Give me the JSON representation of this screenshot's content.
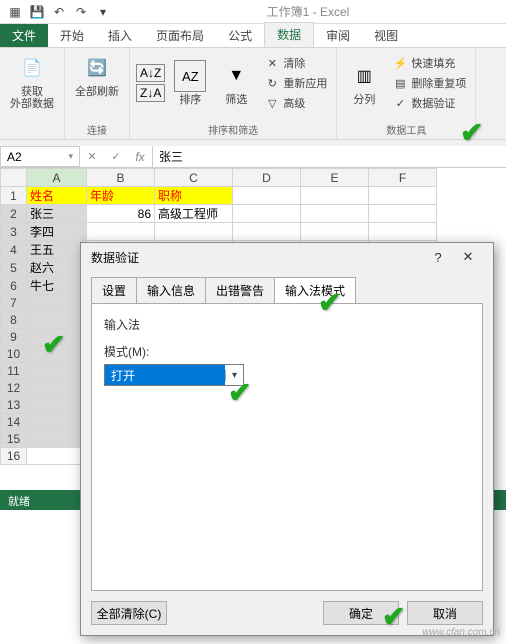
{
  "app": {
    "title": "工作簿1 - Excel"
  },
  "tabs": {
    "file": "文件",
    "home": "开始",
    "insert": "插入",
    "pagelayout": "页面布局",
    "formulas": "公式",
    "data": "数据",
    "review": "审阅",
    "view": "视图"
  },
  "ribbon": {
    "get_ext": "获取\n外部数据",
    "refresh": "全部刷新",
    "conn_group": "连接",
    "conn": "连接",
    "sort": "排序",
    "filter": "筛选",
    "clear": "清除",
    "reapply": "重新应用",
    "advanced": "高级",
    "sortfilter_group": "排序和筛选",
    "text_to_cols": "分列",
    "flash_fill": "快速填充",
    "remove_dup": "删除重复项",
    "data_val": "数据验证",
    "datatools_group": "数据工具"
  },
  "namebox": "A2",
  "formula_value": "张三",
  "headers": {
    "A": "姓名",
    "B": "年龄",
    "C": "职称"
  },
  "rows": [
    {
      "A": "张三",
      "B": "86",
      "C": "高级工程师"
    },
    {
      "A": "李四",
      "B": "",
      "C": ""
    },
    {
      "A": "王五",
      "B": "",
      "C": ""
    },
    {
      "A": "赵六",
      "B": "",
      "C": ""
    },
    {
      "A": "牛七",
      "B": "",
      "C": ""
    }
  ],
  "cols": [
    "A",
    "B",
    "C",
    "D",
    "E",
    "F"
  ],
  "row_count": 16,
  "status": "就绪",
  "dialog": {
    "title": "数据验证",
    "tabs": {
      "settings": "设置",
      "input_msg": "输入信息",
      "error_alert": "出错警告",
      "ime_mode": "输入法模式"
    },
    "section": "输入法",
    "mode_label": "模式(M):",
    "mode_value": "打开",
    "clear_all": "全部清除(C)",
    "ok": "确定",
    "cancel": "取消"
  },
  "watermark": "www.cfan.com.cn"
}
